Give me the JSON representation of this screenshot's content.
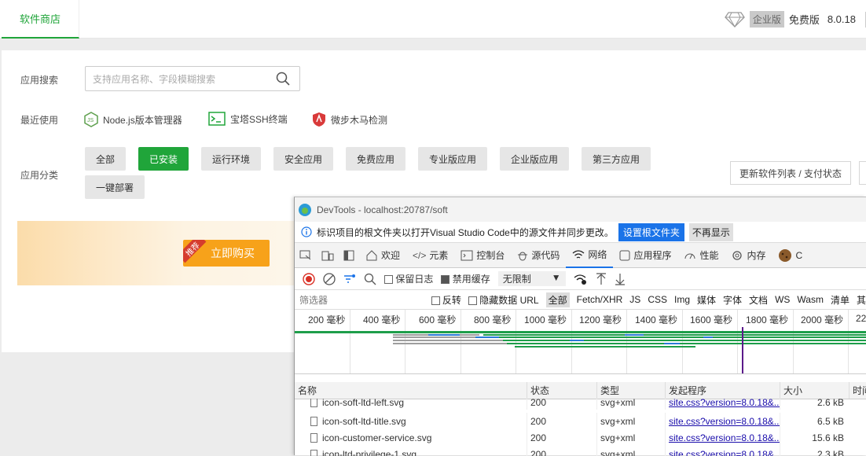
{
  "topbar": {
    "tab_store": "软件商店",
    "edition_badge": "企业版",
    "edition_free": "免费版",
    "version": "8.0.18"
  },
  "search": {
    "label": "应用搜索",
    "placeholder": "支持应用名称、字段模糊搜索"
  },
  "recent": {
    "label": "最近使用",
    "items": [
      "Node.js版本管理器",
      "宝塔SSH终端",
      "微步木马检测"
    ]
  },
  "categories": {
    "label": "应用分类",
    "buttons": [
      "全部",
      "已安装",
      "运行环境",
      "安全应用",
      "免费应用",
      "专业版应用",
      "企业版应用",
      "第三方应用",
      "一键部署"
    ],
    "active": "已安装",
    "update_btn": "更新软件列表 / 支付状态"
  },
  "banner": {
    "tag": "推荐",
    "buy": "立即购买"
  },
  "devtools": {
    "title": "DevTools - localhost:20787/soft",
    "info_text": "标识项目的根文件夹以打开Visual Studio Code中的源文件并同步更改。",
    "info_btn_primary": "设置根文件夹",
    "info_btn_secondary": "不再显示",
    "tabs": [
      "欢迎",
      "元素",
      "控制台",
      "源代码",
      "网络",
      "应用程序",
      "性能",
      "内存",
      "C"
    ],
    "active_tab": "网络",
    "toolbar": {
      "preserve_log": "保留日志",
      "disable_cache": "禁用缓存",
      "throttle": "无限制"
    },
    "filter": {
      "placeholder": "筛选器",
      "invert": "反转",
      "hide_data_url": "隐藏数据 URL",
      "types": [
        "全部",
        "Fetch/XHR",
        "JS",
        "CSS",
        "Img",
        "媒体",
        "字体",
        "文档",
        "WS",
        "Wasm",
        "清单",
        "其"
      ]
    },
    "timeline_ticks": [
      "200 毫秒",
      "400 毫秒",
      "600 毫秒",
      "800 毫秒",
      "1000 毫秒",
      "1200 毫秒",
      "1400 毫秒",
      "1600 毫秒",
      "1800 毫秒",
      "2000 毫秒",
      "22"
    ],
    "columns": [
      "名称",
      "状态",
      "类型",
      "发起程序",
      "大小",
      "时间"
    ],
    "rows": [
      {
        "name": "icon-soft-ltd-left.svg",
        "status": "200",
        "type": "svg+xml",
        "initiator": "site.css?version=8.0.18&...",
        "size": "2.6 kB"
      },
      {
        "name": "icon-soft-ltd-title.svg",
        "status": "200",
        "type": "svg+xml",
        "initiator": "site.css?version=8.0.18&...",
        "size": "6.5 kB"
      },
      {
        "name": "icon-customer-service.svg",
        "status": "200",
        "type": "svg+xml",
        "initiator": "site.css?version=8.0.18&...",
        "size": "15.6 kB"
      },
      {
        "name": "icon-ltd-privilege-1.svg",
        "status": "200",
        "type": "svg+xml",
        "initiator": "site.css?version=8.0.18&...",
        "size": "2.3 kB"
      }
    ]
  },
  "colors": {
    "accent": "#20a53a",
    "buy": "#f7a21a",
    "devtools_blue": "#1a73e8"
  }
}
